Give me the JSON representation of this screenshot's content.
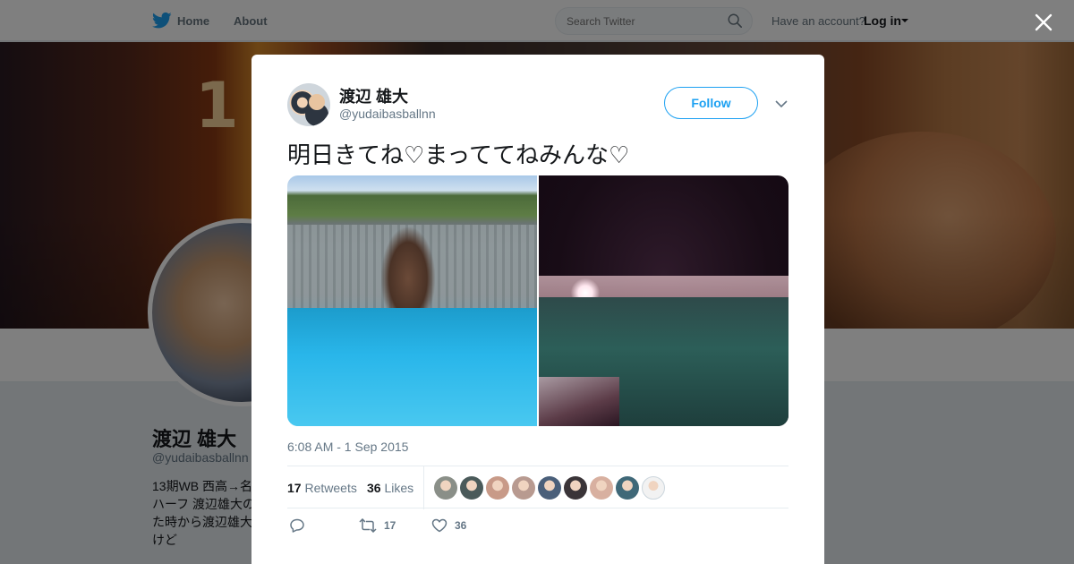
{
  "topbar": {
    "home_label": "Home",
    "about_label": "About",
    "search_placeholder": "Search Twitter",
    "account_prompt": "Have an account?",
    "login_label": "Log in"
  },
  "banner": {
    "digit_text": "1"
  },
  "profile": {
    "name": "渡辺 雄大",
    "handle": "@yudaibasballnn",
    "bio_lines": [
      "13期WB 西高→名",
      "ハーフ 渡辺雄大の",
      "た時から渡辺雄大",
      "けど"
    ]
  },
  "tweet": {
    "author_name": "渡辺 雄大",
    "author_handle": "@yudaibasballnn",
    "follow_label": "Follow",
    "text": "明日きてね♡まっててねみんな♡",
    "timestamp": "6:08 AM - 1 Sep 2015",
    "retweets_count": "17",
    "retweets_label": "Retweets",
    "likes_count": "36",
    "likes_label": "Likes",
    "action_retweet_count": "17",
    "action_like_count": "36",
    "liker_colors": [
      "#8a8f88",
      "#4a5a5a",
      "#c89a88",
      "#b89a90",
      "#4a5f7a",
      "#3a3438",
      "#d8b0a0",
      "#3f6878",
      "#f2f2f2"
    ]
  },
  "colors": {
    "accent": "#1da1f2",
    "secondary_text": "#657786",
    "primary_text": "#14171a"
  },
  "icons": [
    "twitter-bird-icon",
    "search-icon",
    "caret-down-icon",
    "close-icon",
    "chevron-down-icon",
    "reply-icon",
    "retweet-icon",
    "heart-icon"
  ]
}
